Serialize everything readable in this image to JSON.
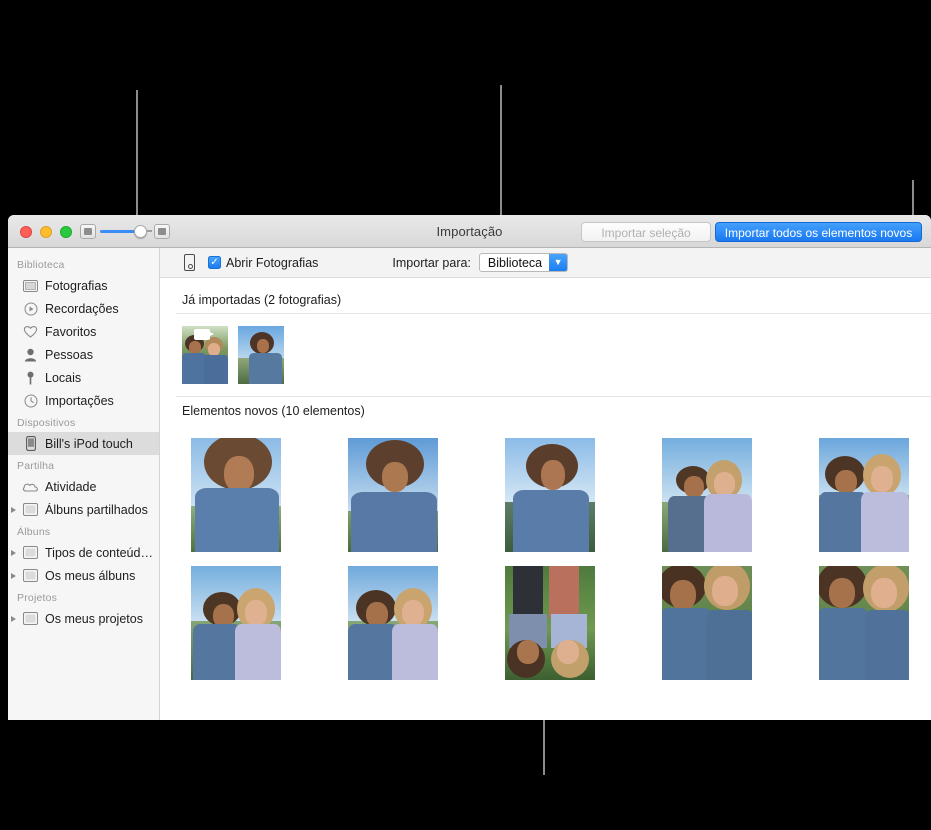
{
  "window": {
    "title": "Importação",
    "toolbar": {
      "zoom_out_icon": "photo-small-icon",
      "zoom_in_icon": "photo-large-icon",
      "import_selection_label": "Importar seleção",
      "import_all_label": "Importar todos os elementos novos",
      "accent_color": "#1a79f2"
    }
  },
  "sidebar": {
    "groups": [
      {
        "title": "Biblioteca",
        "items": [
          {
            "label": "Fotografias",
            "icon": "photos-icon",
            "disclosure": false,
            "selected": false
          },
          {
            "label": "Recordações",
            "icon": "memories-icon",
            "disclosure": false,
            "selected": false
          },
          {
            "label": "Favoritos",
            "icon": "heart-icon",
            "disclosure": false,
            "selected": false
          },
          {
            "label": "Pessoas",
            "icon": "person-icon",
            "disclosure": false,
            "selected": false
          },
          {
            "label": "Locais",
            "icon": "pin-icon",
            "disclosure": false,
            "selected": false
          },
          {
            "label": "Importações",
            "icon": "clock-icon",
            "disclosure": false,
            "selected": false
          }
        ]
      },
      {
        "title": "Dispositivos",
        "items": [
          {
            "label": "Bill's iPod touch",
            "icon": "ipod-icon",
            "disclosure": false,
            "selected": true
          }
        ]
      },
      {
        "title": "Partilha",
        "items": [
          {
            "label": "Atividade",
            "icon": "cloud-icon",
            "disclosure": false,
            "selected": false
          },
          {
            "label": "Álbuns partilhados",
            "icon": "album-icon",
            "disclosure": true,
            "selected": false
          }
        ]
      },
      {
        "title": "Álbuns",
        "items": [
          {
            "label": "Tipos de conteúdo ...",
            "icon": "album-icon",
            "disclosure": true,
            "selected": false
          },
          {
            "label": "Os meus álbuns",
            "icon": "album-icon",
            "disclosure": true,
            "selected": false
          }
        ]
      },
      {
        "title": "Projetos",
        "items": [
          {
            "label": "Os meus projetos",
            "icon": "album-icon",
            "disclosure": true,
            "selected": false
          }
        ]
      }
    ]
  },
  "import_bar": {
    "device_icon": "iphone-icon",
    "open_photos_checked": "✓",
    "open_photos_label": "Abrir Fotografias",
    "destination_label": "Importar para:",
    "destination_value": "Biblioteca",
    "destination_arrow": "▼"
  },
  "sections": [
    {
      "heading": "Já importadas (2 fotografias)",
      "count": 2
    },
    {
      "heading": "Elementos novos (10 elementos)",
      "count": 10
    }
  ]
}
